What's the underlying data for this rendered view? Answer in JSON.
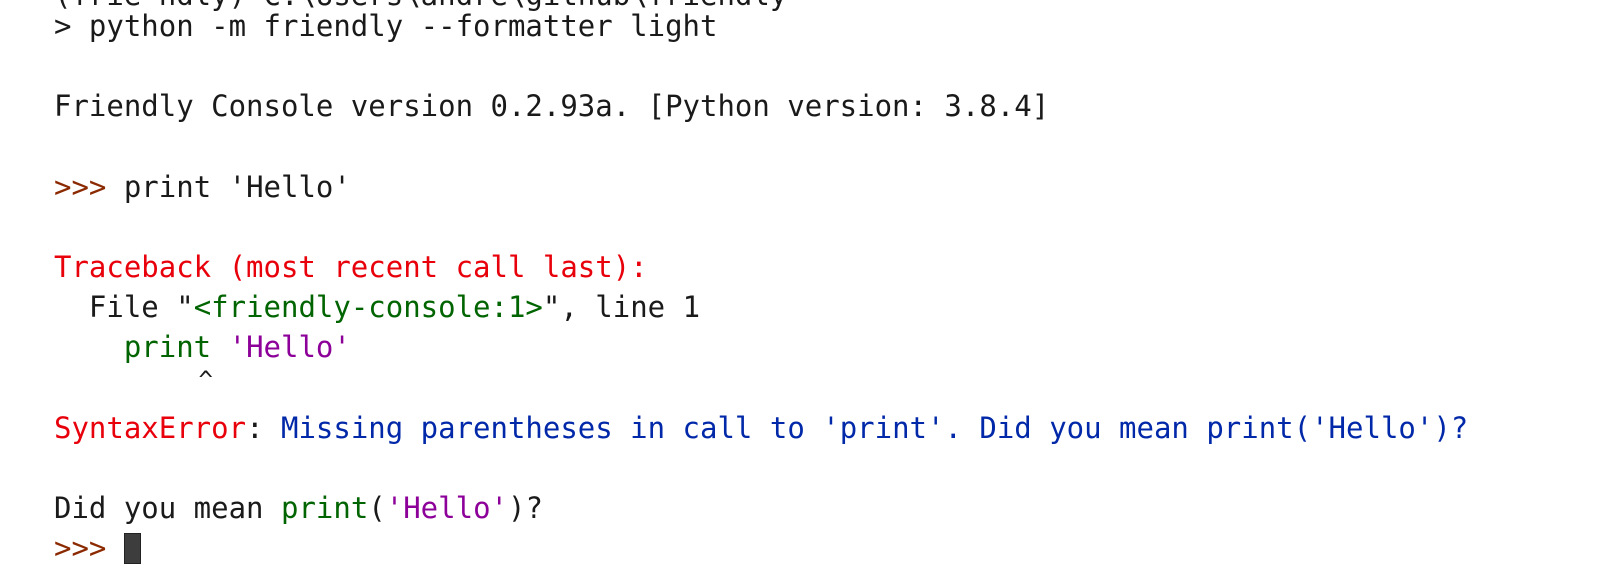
{
  "terminal": {
    "clipped_top_line": "(frie ndly) C:\\Users\\andre\\github\\friendly",
    "command": "> python -m friendly --formatter light",
    "version_line": "Friendly Console version 0.2.93a. [Python version: 3.8.4]",
    "input_prompt": ">>>",
    "input_code": " print 'Hello'",
    "traceback_header": "Traceback (most recent call last):",
    "file_prefix": "  File \"",
    "file_name": "<friendly-console:1>",
    "file_suffix": "\", line 1",
    "code_indent": "    ",
    "code_print": "print",
    "code_space": " ",
    "code_string": "'Hello'",
    "caret_line": "          ^",
    "error_type": "SyntaxError",
    "error_colon": ":",
    "error_message": " Missing parentheses in call to 'print'. Did you mean print('Hello')?",
    "hint_prefix": "Did you mean ",
    "hint_print": "print",
    "hint_paren_open": "(",
    "hint_string": "'Hello'",
    "hint_paren_close": ")",
    "hint_question": "?",
    "final_prompt": ">>> "
  },
  "colors": {
    "prompt": "#8b2a00",
    "error": "#e8000b",
    "code_keyword": "#006400",
    "code_string": "#8c0099",
    "message": "#0028a8"
  }
}
